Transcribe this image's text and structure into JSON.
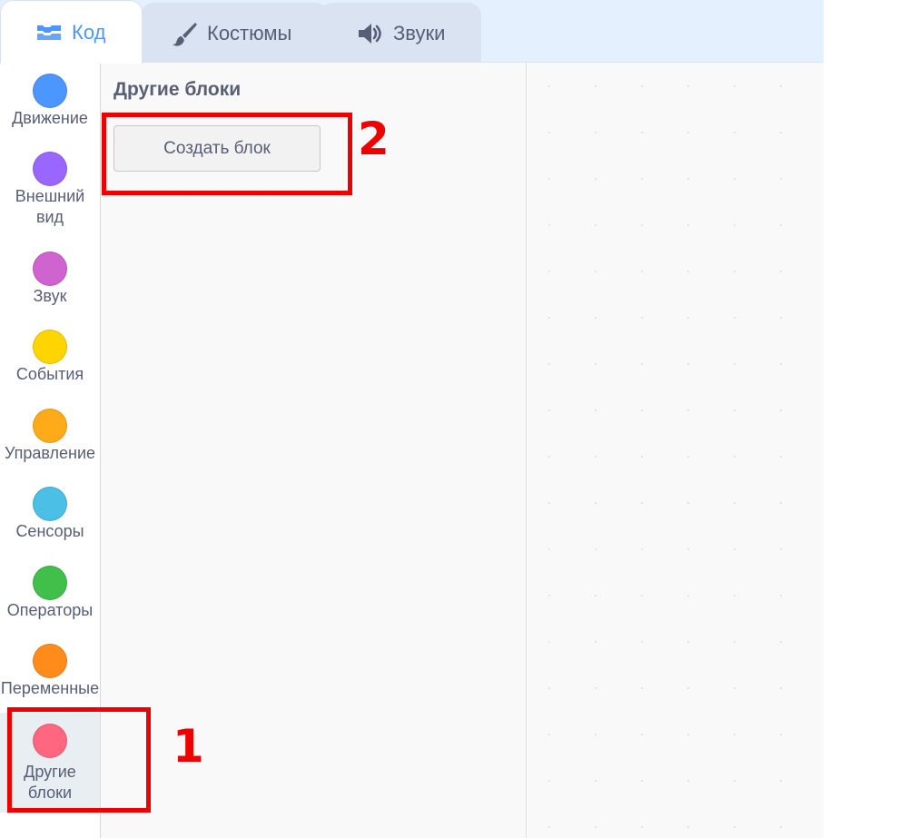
{
  "tabs": [
    {
      "label": "Код",
      "icon": "code-icon",
      "active": true
    },
    {
      "label": "Костюмы",
      "icon": "paintbrush-icon",
      "active": false
    },
    {
      "label": "Звуки",
      "icon": "speaker-icon",
      "active": false
    }
  ],
  "categories": [
    {
      "label": "Движение",
      "color": "#4c97ff"
    },
    {
      "label": "Внешний вид",
      "color": "#9966ff"
    },
    {
      "label": "Звук",
      "color": "#cf63cf"
    },
    {
      "label": "События",
      "color": "#ffd500"
    },
    {
      "label": "Управление",
      "color": "#ffab19"
    },
    {
      "label": "Сенсоры",
      "color": "#4cbfe6"
    },
    {
      "label": "Операторы",
      "color": "#40bf4a"
    },
    {
      "label": "Переменные",
      "color": "#ff8c1a"
    },
    {
      "label": "Другие блоки",
      "color": "#ff6680",
      "selected": true
    }
  ],
  "flyout": {
    "title": "Другие блоки",
    "make_block_label": "Создать блок"
  },
  "annotations": {
    "marker_1": "1",
    "marker_2": "2",
    "color": "#ee0000"
  }
}
